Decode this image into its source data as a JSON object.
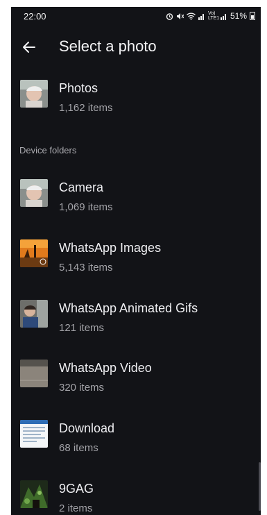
{
  "status_bar": {
    "time": "22:00",
    "network_label": "Vo) LTE1",
    "battery": "51%"
  },
  "app_bar": {
    "title": "Select a photo",
    "back_icon": "arrow-left-icon"
  },
  "top_items": [
    {
      "name": "Photos",
      "count": "1,162 items",
      "thumb": "portrait"
    }
  ],
  "section_label": "Device folders",
  "folders": [
    {
      "name": "Camera",
      "count": "1,069 items",
      "thumb": "portrait"
    },
    {
      "name": "WhatsApp Images",
      "count": "5,143 items",
      "thumb": "orange"
    },
    {
      "name": "WhatsApp Animated Gifs",
      "count": "121 items",
      "thumb": "child"
    },
    {
      "name": "WhatsApp Video",
      "count": "320 items",
      "thumb": "gray"
    },
    {
      "name": "Download",
      "count": "68 items",
      "thumb": "doc"
    },
    {
      "name": "9GAG",
      "count": "2 items",
      "thumb": "green"
    }
  ]
}
